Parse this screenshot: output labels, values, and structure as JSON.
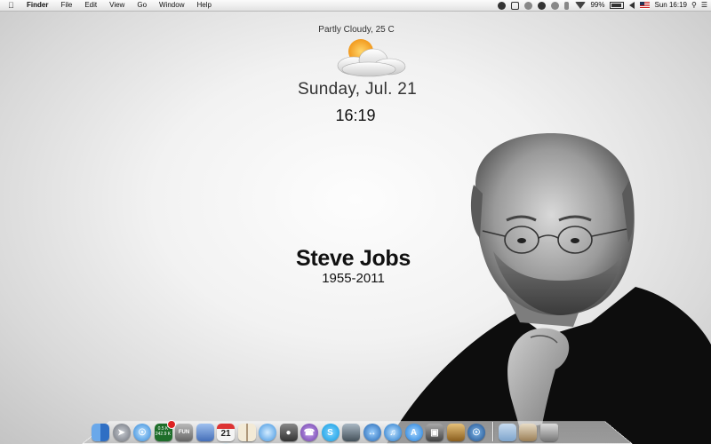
{
  "menubar": {
    "app_name": "Finder",
    "menus": [
      "File",
      "Edit",
      "View",
      "Go",
      "Window",
      "Help"
    ],
    "status_icons": [
      "skype-status-icon",
      "photo-status-icon",
      "headphones-icon",
      "messenger-icon",
      "timemachine-icon",
      "bluetooth-icon",
      "wifi-icon"
    ],
    "battery_percent": "99%",
    "input_source": "us-flag-icon",
    "clock": "Sun 16:19"
  },
  "widget": {
    "weather": "Partly Cloudy, 25 C",
    "date": "Sunday, Jul. 21",
    "time": "16:19"
  },
  "memorial": {
    "name": "Steve Jobs",
    "years": "1955-2011"
  },
  "dock": {
    "apps": [
      {
        "name": "finder-icon",
        "color": "#3f7fd6"
      },
      {
        "name": "launchpad-icon",
        "color": "#8a8f99"
      },
      {
        "name": "safari-icon",
        "color": "#3b93e0"
      },
      {
        "name": "activity-monitor-icon",
        "color": "#2e8a3a"
      },
      {
        "name": "font-book-icon",
        "color": "#777777"
      },
      {
        "name": "preview-icon",
        "color": "#6b8fd0"
      },
      {
        "name": "calendar-icon",
        "color": "#eeeeee"
      },
      {
        "name": "dictionary-icon",
        "color": "#8a5a2b"
      },
      {
        "name": "messages-icon",
        "color": "#4da5f0"
      },
      {
        "name": "facetime-icon",
        "color": "#444444"
      },
      {
        "name": "viber-icon",
        "color": "#7d4fb8"
      },
      {
        "name": "skype-icon",
        "color": "#1ea8e6"
      },
      {
        "name": "iphoto-icon",
        "color": "#5a6e7a"
      },
      {
        "name": "network-icon",
        "color": "#2f78c8"
      },
      {
        "name": "itunes-icon",
        "color": "#2a84d6"
      },
      {
        "name": "app-store-icon",
        "color": "#2a8be0"
      },
      {
        "name": "photo-booth-icon",
        "color": "#555555"
      },
      {
        "name": "keychain-icon",
        "color": "#b88a3a"
      },
      {
        "name": "network-utility-icon",
        "color": "#2b6fb0"
      }
    ],
    "folders": [
      {
        "name": "applications-folder-icon",
        "color": "#8fb4d8"
      },
      {
        "name": "downloads-folder-icon",
        "color": "#b9a07a"
      },
      {
        "name": "trash-icon",
        "color": "#777777"
      }
    ],
    "monitor_up": "0.5 K",
    "monitor_down": "242.9 K",
    "calendar_day": "21"
  },
  "colors": {
    "menubar": "#e9e9e9",
    "text": "#111111",
    "dock_indicator": "#66ccff"
  }
}
